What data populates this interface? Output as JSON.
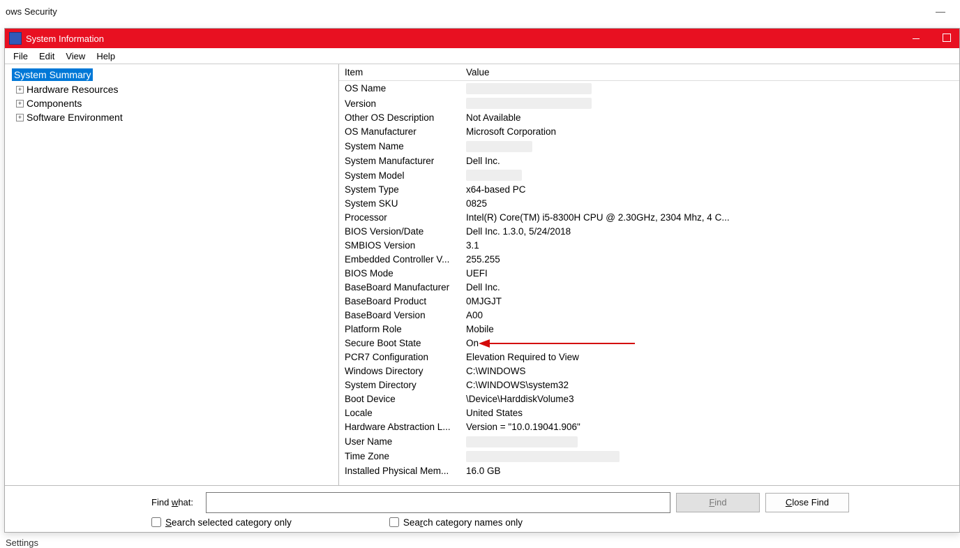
{
  "bg": {
    "title": "ows Security",
    "bottom": "Settings"
  },
  "window": {
    "title": "System Information"
  },
  "menu": {
    "file": "File",
    "edit": "Edit",
    "view": "View",
    "help": "Help"
  },
  "tree": {
    "selected": "System Summary",
    "nodes": {
      "hardware": "Hardware Resources",
      "components": "Components",
      "software": "Software Environment"
    }
  },
  "headers": {
    "item": "Item",
    "value": "Value"
  },
  "rows": [
    {
      "item": "OS Name",
      "value": "",
      "redacted": true,
      "rw": 180
    },
    {
      "item": "Version",
      "value": "",
      "redacted": true,
      "rw": 180
    },
    {
      "item": "Other OS Description",
      "value": "Not Available"
    },
    {
      "item": "OS Manufacturer",
      "value": "Microsoft Corporation"
    },
    {
      "item": "System Name",
      "value": "",
      "redacted": true,
      "rw": 95
    },
    {
      "item": "System Manufacturer",
      "value": "Dell Inc."
    },
    {
      "item": "System Model",
      "value": "",
      "redacted": true,
      "rw": 80
    },
    {
      "item": "System Type",
      "value": "x64-based PC"
    },
    {
      "item": "System SKU",
      "value": "0825"
    },
    {
      "item": "Processor",
      "value": "Intel(R) Core(TM) i5-8300H CPU @ 2.30GHz, 2304 Mhz, 4 C..."
    },
    {
      "item": "BIOS Version/Date",
      "value": "Dell Inc. 1.3.0, 5/24/2018"
    },
    {
      "item": "SMBIOS Version",
      "value": "3.1"
    },
    {
      "item": "Embedded Controller V...",
      "value": "255.255"
    },
    {
      "item": "BIOS Mode",
      "value": "UEFI"
    },
    {
      "item": "BaseBoard Manufacturer",
      "value": "Dell Inc."
    },
    {
      "item": "BaseBoard Product",
      "value": "0MJGJT"
    },
    {
      "item": "BaseBoard Version",
      "value": "A00"
    },
    {
      "item": "Platform Role",
      "value": "Mobile"
    },
    {
      "item": "Secure Boot State",
      "value": "On",
      "arrow": true
    },
    {
      "item": "PCR7 Configuration",
      "value": "Elevation Required to View"
    },
    {
      "item": "Windows Directory",
      "value": "C:\\WINDOWS"
    },
    {
      "item": "System Directory",
      "value": "C:\\WINDOWS\\system32"
    },
    {
      "item": "Boot Device",
      "value": "\\Device\\HarddiskVolume3"
    },
    {
      "item": "Locale",
      "value": "United States"
    },
    {
      "item": "Hardware Abstraction L...",
      "value": "Version = \"10.0.19041.906\""
    },
    {
      "item": "User Name",
      "value": "",
      "redacted": true,
      "rw": 160
    },
    {
      "item": "Time Zone",
      "value": "",
      "redacted": true,
      "rw": 220
    },
    {
      "item": "Installed Physical Mem...",
      "value": "16.0 GB"
    }
  ],
  "find": {
    "label_prefix": "Find ",
    "label_accel": "w",
    "label_suffix": "hat:",
    "value": "",
    "find_btn_accel": "F",
    "find_btn_suffix": "ind",
    "close_btn_prefix": "",
    "close_btn_accel": "C",
    "close_btn_suffix": "lose Find",
    "chk1_accel": "S",
    "chk1_suffix": "earch selected category only",
    "chk2_prefix": "Sea",
    "chk2_accel": "r",
    "chk2_suffix": "ch category names only"
  }
}
